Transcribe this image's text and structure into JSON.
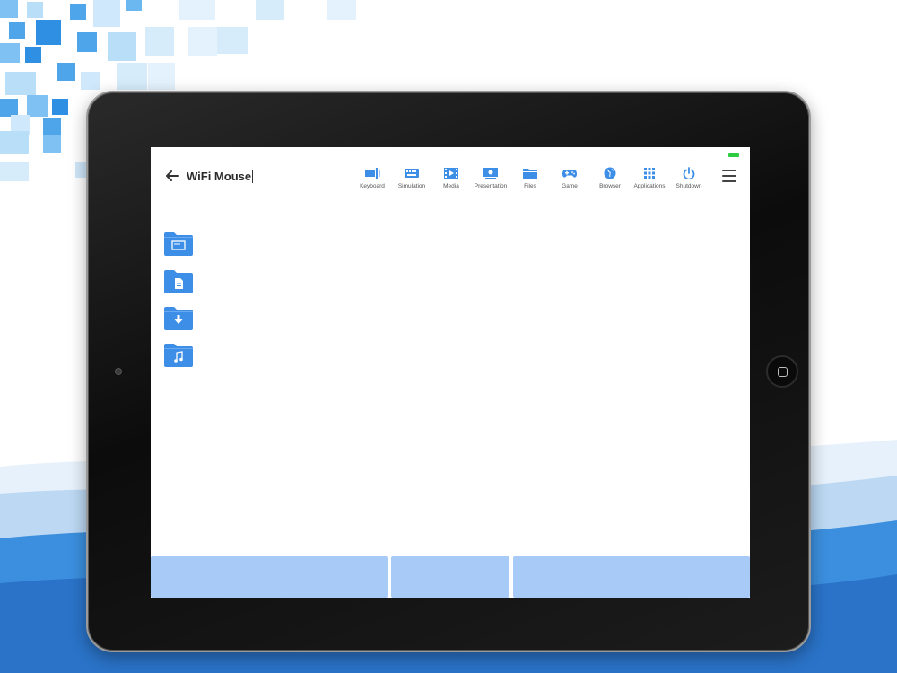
{
  "app": {
    "title": "WiFi Mouse"
  },
  "colors": {
    "accent": "#3d8ee6",
    "bottom_button": "#a7cbf6",
    "battery": "#2ecc40"
  },
  "toolbar": {
    "items": [
      {
        "label": "Keyboard",
        "icon": "keyboard-icon"
      },
      {
        "label": "Simulation",
        "icon": "simulation-keyboard-icon"
      },
      {
        "label": "Media",
        "icon": "media-film-icon"
      },
      {
        "label": "Presentation",
        "icon": "presentation-icon"
      },
      {
        "label": "Files",
        "icon": "folder-icon"
      },
      {
        "label": "Game",
        "icon": "gamepad-icon"
      },
      {
        "label": "Browser",
        "icon": "globe-icon"
      },
      {
        "label": "Applications",
        "icon": "grid-apps-icon"
      },
      {
        "label": "Shutdown",
        "icon": "power-icon"
      }
    ]
  },
  "folders": [
    {
      "icon": "desktop-folder-icon"
    },
    {
      "icon": "documents-folder-icon"
    },
    {
      "icon": "downloads-folder-icon"
    },
    {
      "icon": "music-folder-icon"
    }
  ],
  "bottom_buttons": [
    {
      "label": ""
    },
    {
      "label": ""
    },
    {
      "label": ""
    }
  ]
}
